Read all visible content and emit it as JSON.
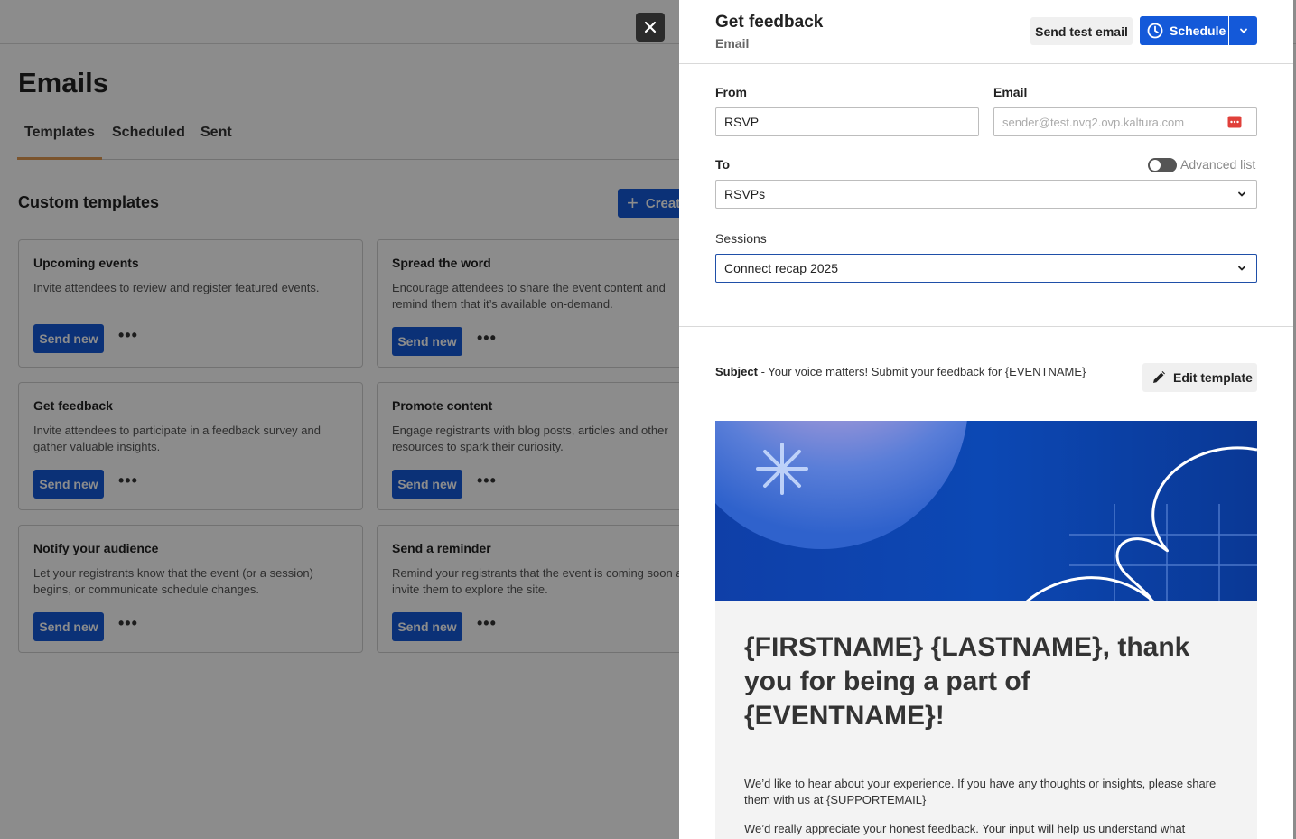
{
  "background": {
    "page_title": "Emails",
    "tabs": [
      {
        "label": "Templates",
        "active": true
      },
      {
        "label": "Scheduled",
        "active": false
      },
      {
        "label": "Sent",
        "active": false
      }
    ],
    "section_title": "Custom templates",
    "create_label": "Creat",
    "send_label": "Send new",
    "cards": [
      {
        "title": "Upcoming events",
        "desc": "Invite attendees to review and register featured events."
      },
      {
        "title": "Spread the word",
        "desc": "Encourage attendees to share the event content and remind them that it’s available on-demand."
      },
      {
        "title": "Get feedback",
        "desc": "Invite attendees to participate in a feedback survey and gather valuable insights."
      },
      {
        "title": "Promote content",
        "desc": "Engage registrants with blog posts, articles and other resources to spark their curiosity."
      },
      {
        "title": "Notify your audience",
        "desc": "Let your registrants know that the event (or a session) begins, or communicate schedule changes."
      },
      {
        "title": "Send a reminder",
        "desc": "Remind your registrants that the event is coming soon and invite them to explore the site."
      }
    ]
  },
  "panel": {
    "title": "Get feedback",
    "subtitle": "Email",
    "send_test_label": "Send test email",
    "schedule_label": "Schedule",
    "from_label": "From",
    "from_value": "RSVP",
    "email_label": "Email",
    "email_placeholder": "sender@test.nvq2.ovp.kaltura.com",
    "to_label": "To",
    "advanced_list_label": "Advanced list",
    "to_value": "RSVPs",
    "sessions_label": "Sessions",
    "sessions_value": "Connect recap 2025",
    "subject_label": "Subject",
    "subject_value": " - Your voice matters! Submit your feedback for {EVENTNAME}",
    "edit_template_label": "Edit template"
  },
  "email_preview": {
    "heading": "{FIRSTNAME} {LASTNAME}, thank you for being a part of {EVENTNAME}!",
    "paragraph1": "We’d like to hear about your experience. If you have any thoughts or insights, please share them with us at {SUPPORTEMAIL}",
    "paragraph2": "We’d really appreciate your honest feedback. Your input will help us understand what"
  },
  "colors": {
    "primary": "#1459d9",
    "tab_underline": "#e09a52",
    "hero_blue": "#0a3a9e",
    "email_icon_red": "#e0403a"
  },
  "icons": [
    "close-icon",
    "clock-icon",
    "chevron-down-icon",
    "pencil-icon",
    "plus-icon",
    "more-dots-icon",
    "contact-card-icon",
    "asterisk-icon"
  ]
}
